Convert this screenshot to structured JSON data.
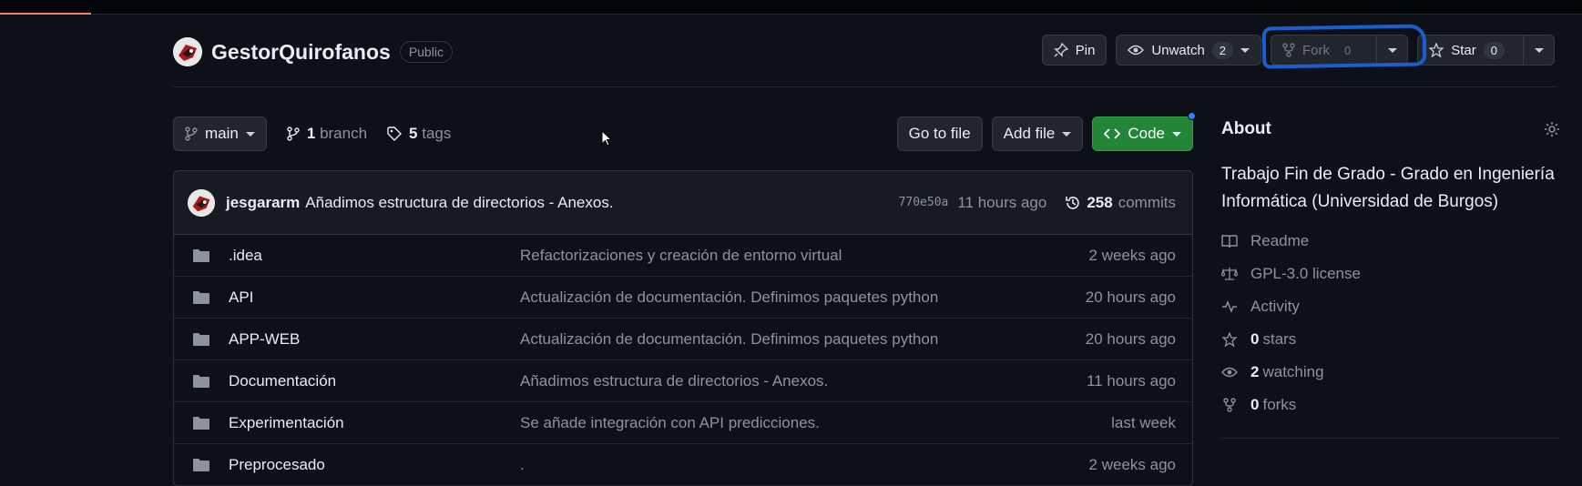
{
  "repo": {
    "name": "GestorQuirofanos",
    "visibility": "Public"
  },
  "actions": {
    "pin": "Pin",
    "unwatch": "Unwatch",
    "watch_count": "2",
    "fork": "Fork",
    "fork_count": "0",
    "star": "Star",
    "star_count": "0"
  },
  "toolbar": {
    "branch": "main",
    "branch_count": "1",
    "branch_label": "branch",
    "tag_count": "5",
    "tag_label": "tags",
    "go_to_file": "Go to file",
    "add_file": "Add file",
    "code": "Code"
  },
  "latest_commit": {
    "user": "jesgararm",
    "message": "Añadimos estructura de directorios - Anexos.",
    "sha": "770e50a",
    "ago": "11 hours ago",
    "count": "258",
    "count_label": "commits"
  },
  "files": [
    {
      "name": ".idea",
      "message": "Refactorizaciones y creación de entorno virtual",
      "when": "2 weeks ago"
    },
    {
      "name": "API",
      "message": "Actualización de documentación. Definimos paquetes python",
      "when": "20 hours ago"
    },
    {
      "name": "APP-WEB",
      "message": "Actualización de documentación. Definimos paquetes python",
      "when": "20 hours ago"
    },
    {
      "name": "Documentación",
      "message": "Añadimos estructura de directorios - Anexos.",
      "when": "11 hours ago"
    },
    {
      "name": "Experimentación",
      "message": "Se añade integración con API predicciones.",
      "when": "last week"
    },
    {
      "name": "Preprocesado",
      "message": ".",
      "when": "2 weeks ago"
    }
  ],
  "about": {
    "title": "About",
    "description": "Trabajo Fin de Grado - Grado en Ingeniería Informática (Universidad de Burgos)",
    "readme": "Readme",
    "license": "GPL-3.0 license",
    "activity": "Activity",
    "stars_count": "0",
    "stars_label": "stars",
    "watching_count": "2",
    "watching_label": "watching",
    "forks_count": "0",
    "forks_label": "forks"
  },
  "colors": {
    "background": "#0d1117",
    "code_button": "#238636",
    "annotation": "#1a5fd0"
  }
}
